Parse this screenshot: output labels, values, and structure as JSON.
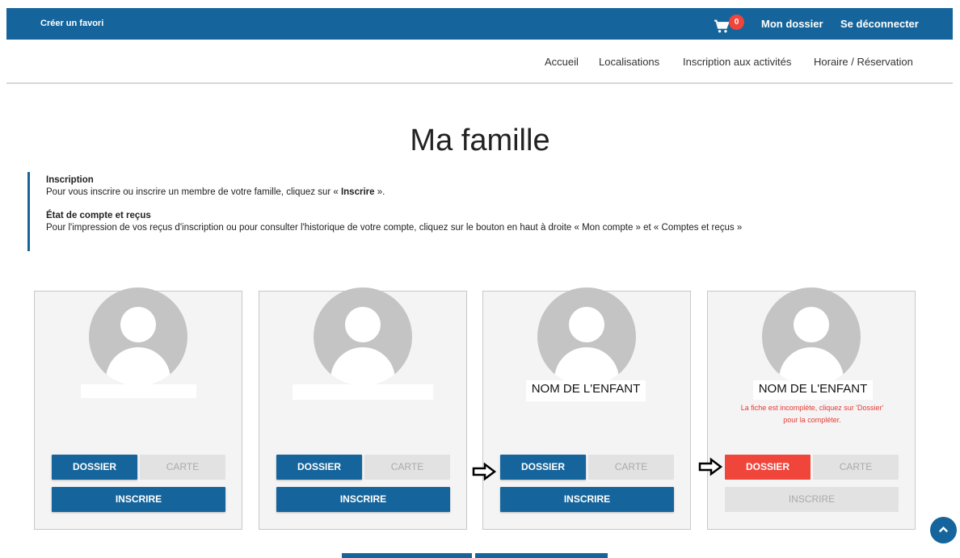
{
  "topbar": {
    "favorite": "Créer un favori",
    "cart_count": "0",
    "my_file": "Mon dossier",
    "logout": "Se déconnecter"
  },
  "nav": {
    "items": [
      "Accueil",
      "Localisations",
      "Inscription aux activités",
      "Horaire / Réservation"
    ]
  },
  "page_title": "Ma famille",
  "info": {
    "h1": "Inscription",
    "p1_pre": "Pour vous inscrire ou inscrire un membre de votre famille, cliquez sur « ",
    "p1_bold": "Inscrire",
    "p1_post": " ».",
    "h2": "État de compte et reçus",
    "p2": "Pour l'impression de vos reçus d'inscription ou pour consulter l'historique de votre compte, cliquez sur le bouton en haut à droite « Mon compte » et « Comptes et reçus »"
  },
  "cards": [
    {
      "name": "",
      "warning": "",
      "dossier": "DOSSIER",
      "carte": "CARTE",
      "inscrire": "INSCRIRE"
    },
    {
      "name": "",
      "warning": "",
      "dossier": "DOSSIER",
      "carte": "CARTE",
      "inscrire": "INSCRIRE"
    },
    {
      "name": "NOM DE L'ENFANT",
      "warning": "",
      "dossier": "DOSSIER",
      "carte": "CARTE",
      "inscrire": "INSCRIRE"
    },
    {
      "name": "NOM DE L'ENFANT",
      "warning_line1": "La fiche est incomplète, cliquez sur 'Dossier'",
      "warning_line2": "pour la compléter.",
      "dossier": "DOSSIER",
      "carte": "CARTE",
      "inscrire": "INSCRIRE"
    }
  ],
  "colors": {
    "primary": "#15659c",
    "danger": "#f0453a",
    "disabled": "#e2e2e2"
  }
}
